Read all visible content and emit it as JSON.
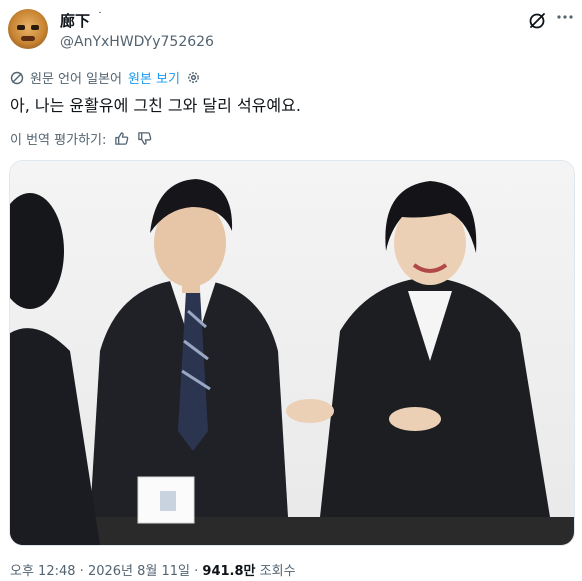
{
  "author": {
    "name": "廊下",
    "name_suffix": "˙",
    "handle": "@AnYxHWDYy752626"
  },
  "translation": {
    "original_language_label": "원문 언어 일본어",
    "show_original_label": "원본 보기"
  },
  "tweet": {
    "text": "아, 나는 윤활유에 그친 그와 달리 석유예요."
  },
  "rate": {
    "label": "이 번역 평가하기:"
  },
  "meta": {
    "time": "오후 12:48",
    "sep1": "·",
    "date": "2026년 8월 11일",
    "sep2": "·",
    "views": "941.8만",
    "views_label": "조회수"
  },
  "colors": {
    "link": "#1d9bf0",
    "muted": "#536471",
    "text": "#0f1419"
  },
  "icons": [
    "grok-icon",
    "more-icon",
    "translate-icon",
    "gear-icon",
    "thumbs-up-icon",
    "thumbs-down-icon"
  ]
}
